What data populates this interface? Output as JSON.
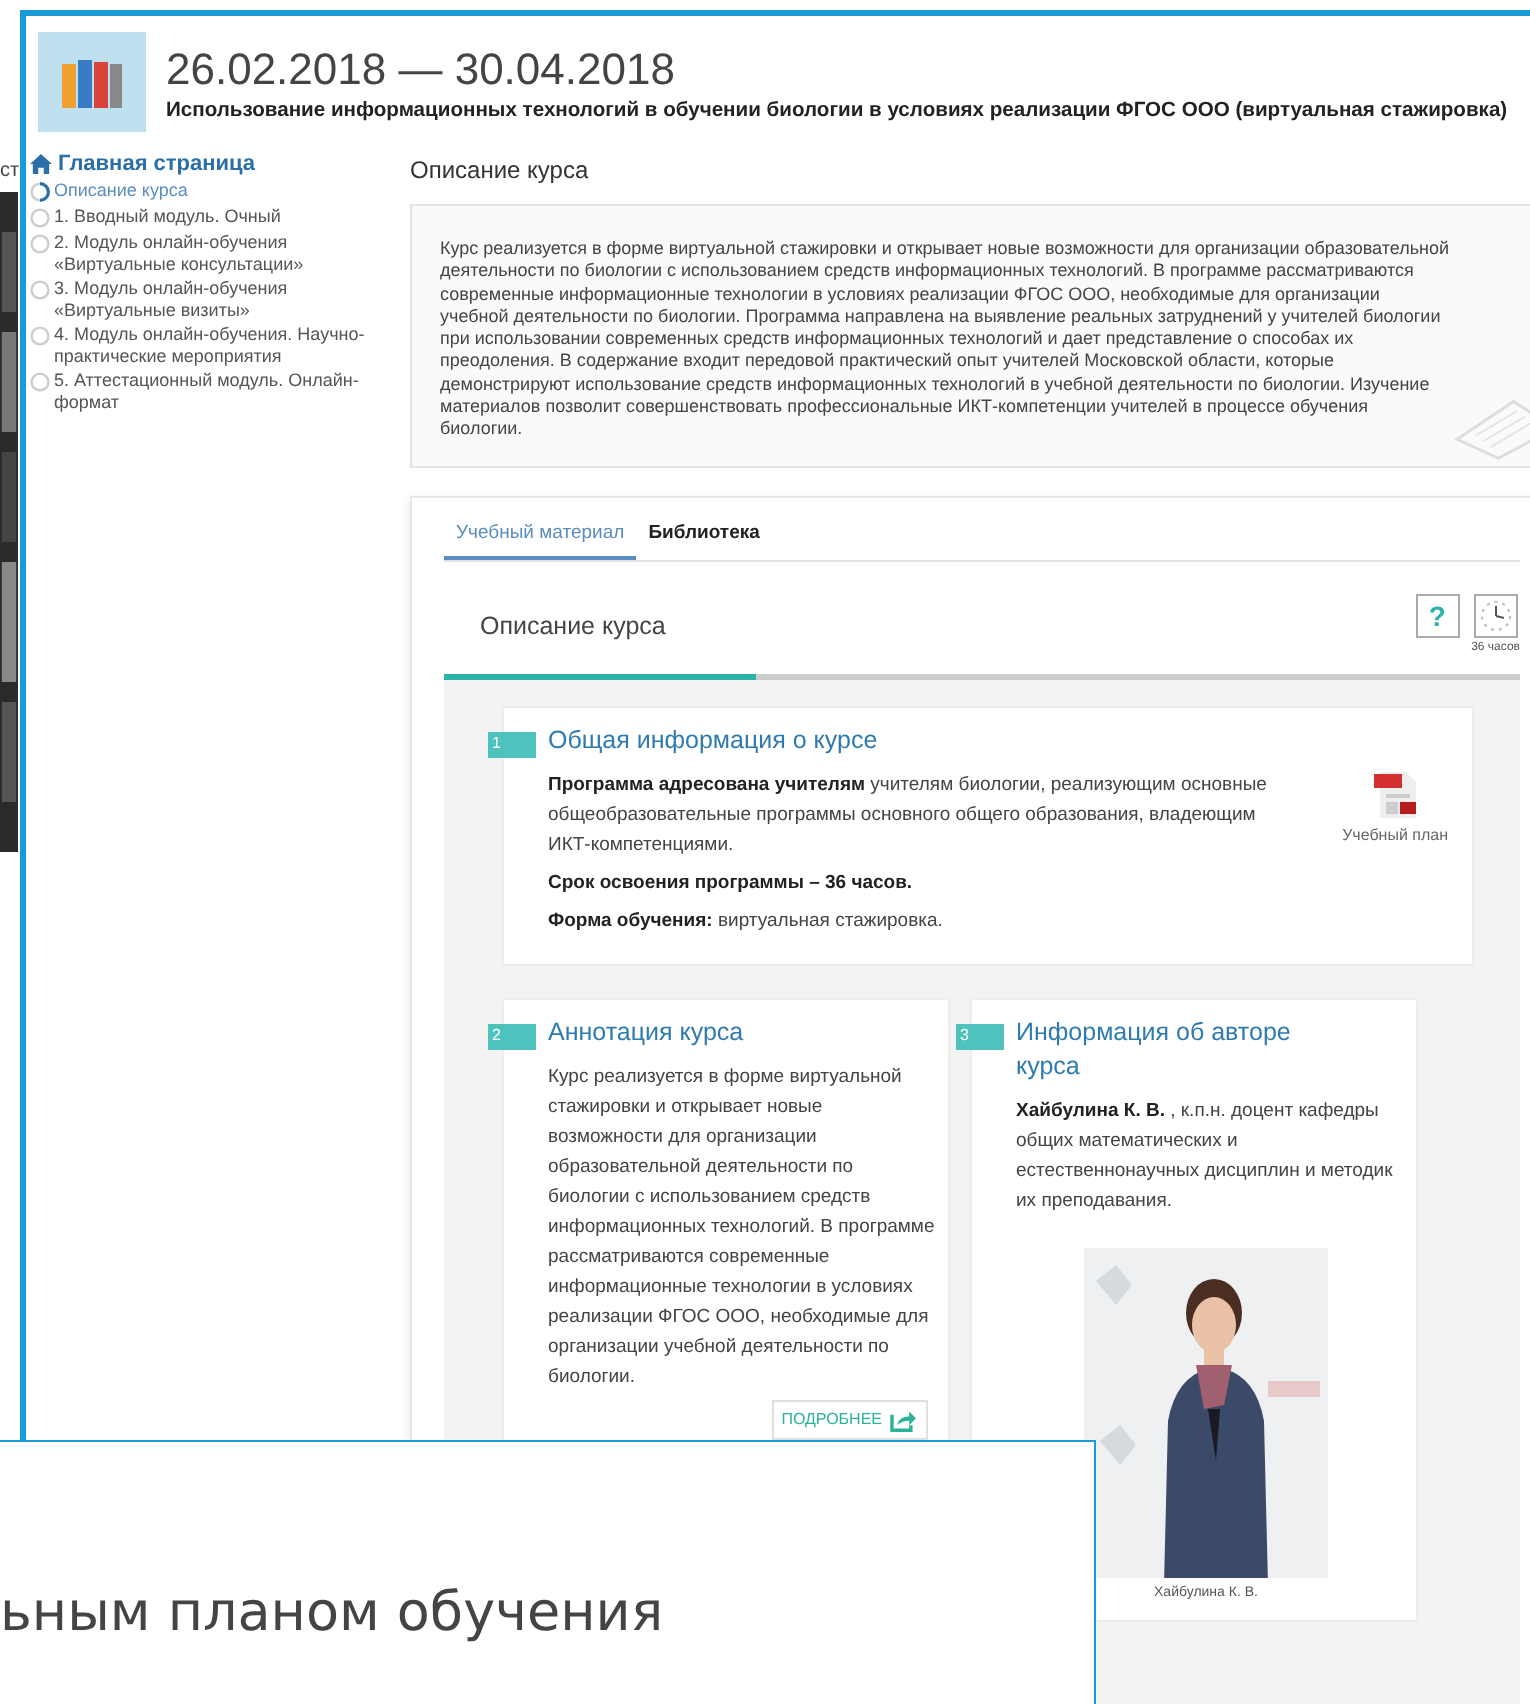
{
  "edge_text": "ст",
  "header": {
    "dates": "26.02.2018 — 30.04.2018",
    "title": "Использование информационных технологий в обучении биологии в условиях реализации ФГОС ООО (виртуальная стажировка)"
  },
  "sidebar": {
    "home": "Главная страница",
    "items": [
      {
        "label": "Описание курса",
        "selected": true
      },
      {
        "label": "1. Вводный модуль. Очный",
        "selected": false
      },
      {
        "label": "2. Модуль онлайн-обучения «Виртуальные консультации»",
        "selected": false
      },
      {
        "label": "3. Модуль онлайн-обучения «Виртуальные визиты»",
        "selected": false
      },
      {
        "label": "4. Модуль онлайн-обучения. Научно-практические мероприятия",
        "selected": false
      },
      {
        "label": "5. Аттестационный модуль. Онлайн-формат",
        "selected": false
      }
    ]
  },
  "page_title": "Описание курса",
  "description": "Курс реализуется в форме виртуальной стажировки и открывает новые возможности для организации образовательной деятельности по биологии с использованием средств информационных технологий. В программе рассматриваются современные информационные технологии в условиях реализации ФГОС ООО, необходимые для организации учебной деятельности по биологии. Программа направлена на выявление реальных затруднений у учителей биологии при использовании современных средств информационных технологий и дает представление о способах их преодоления. В содержание входит передовой практический опыт учителей Московской области, которые демонстрируют использование средств информационных технологий в учебной деятельности по биологии. Изучение материалов позволит совершенствовать профессиональные ИКТ-компетенции учителей в процессе обучения биологии.",
  "tabs": [
    {
      "label": "Учебный материал",
      "selected": true
    },
    {
      "label": "Библиотека",
      "selected": false
    }
  ],
  "section": {
    "title": "Описание курса",
    "help": "?",
    "duration": "36 часов",
    "progress": {
      "level": 0.29
    }
  },
  "cards": [
    {
      "kind": "info",
      "number": "1",
      "title": "Общая информация о курсе",
      "paragraphs": [
        {
          "text": "**Программа адресована учителям** учителям биологии, реализующим основные общеобразовательные программы основного общего образования, владеющим ИКТ-компетенциями.",
          "bold": false
        },
        {
          "text": "Срок освоения программы – 36 часов.",
          "bold": true
        },
        {
          "text": "**Форма обучения:** виртуальная стажировка.",
          "bold": false
        }
      ],
      "attachment": "Учебный план"
    },
    {
      "kind": "annotation",
      "number": "2",
      "title": "Аннотация курса",
      "text": "Курс реализуется в форме виртуальной стажировки и открывает новые возможности для организации образовательной деятельности по биологии с использованием средств информационных технологий. В программе рассматриваются современные информационные технологии в условиях реализации ФГОС ООО, необходимые для организации учебной деятельности по биологии.",
      "more": "ПОДРОБНЕЕ"
    },
    {
      "kind": "author",
      "number": "3",
      "title": "Информация об авторе курса",
      "text": "**Хайбулина К. В.** , к.п.н. доцент кафедры общих математических и естественнонаучных дисциплин и методик их преподавания.",
      "caption": "Хайбулина К. В."
    }
  ],
  "overlay_text": "ьным планом обучения"
}
